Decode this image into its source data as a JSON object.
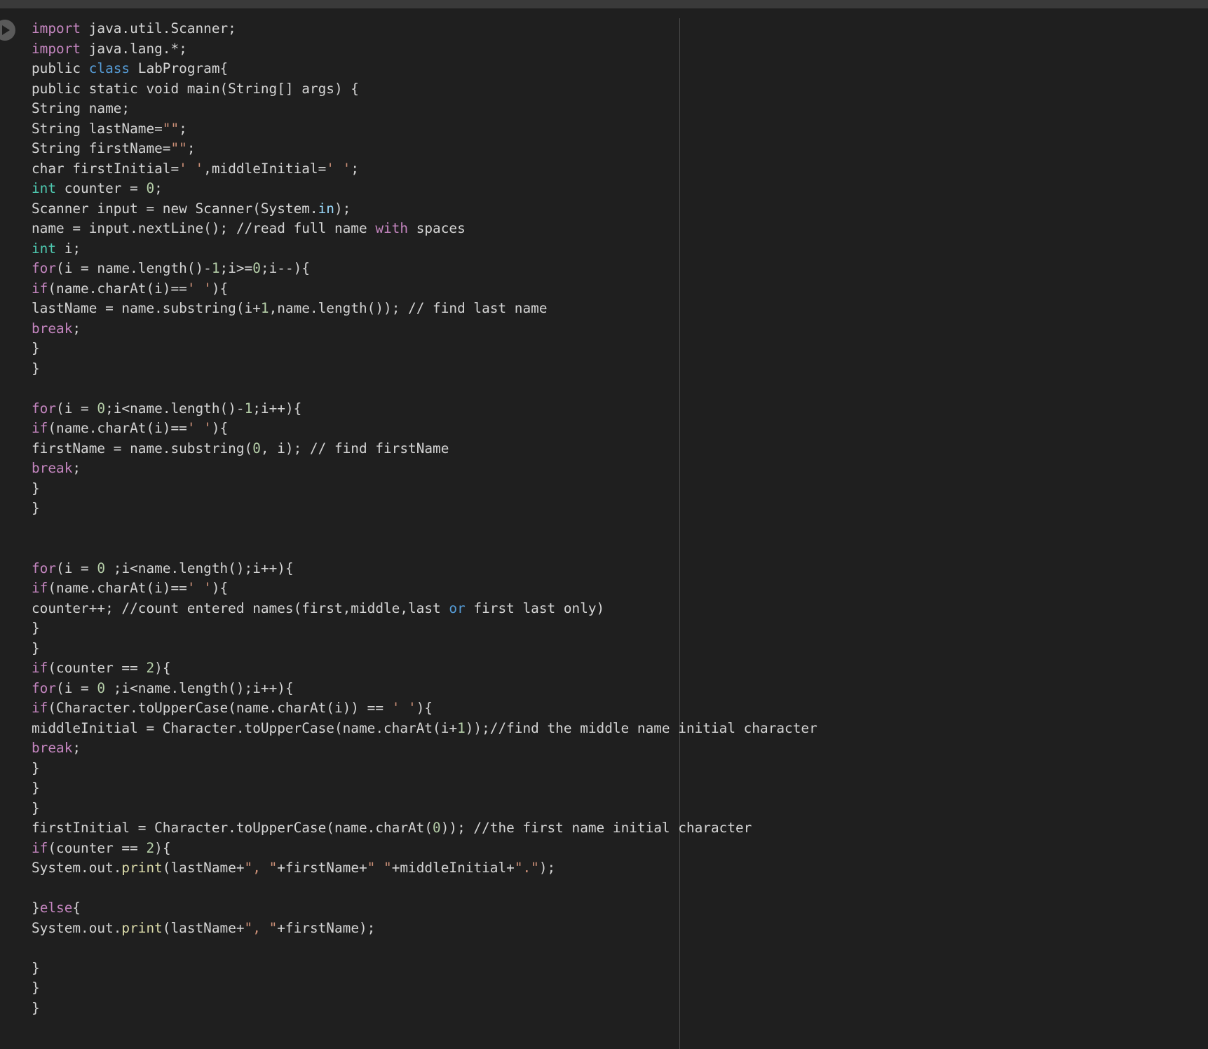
{
  "editor": {
    "run_button_icon": "play-icon",
    "language": "java",
    "lines": [
      [
        {
          "t": "import",
          "c": "kw"
        },
        {
          "t": " java.util.Scanner;"
        }
      ],
      [
        {
          "t": "import",
          "c": "kw"
        },
        {
          "t": " java.lang.*;"
        }
      ],
      [
        {
          "t": "public "
        },
        {
          "t": "class",
          "c": "blue"
        },
        {
          "t": " LabProgram{"
        }
      ],
      [
        {
          "t": "public static void main(String[] args) {"
        }
      ],
      [
        {
          "t": "String name;"
        }
      ],
      [
        {
          "t": "String lastName="
        },
        {
          "t": "\"\"",
          "c": "str"
        },
        {
          "t": ";"
        }
      ],
      [
        {
          "t": "String firstName="
        },
        {
          "t": "\"\"",
          "c": "str"
        },
        {
          "t": ";"
        }
      ],
      [
        {
          "t": "char firstInitial="
        },
        {
          "t": "' '",
          "c": "str"
        },
        {
          "t": ",middleInitial="
        },
        {
          "t": "' '",
          "c": "str"
        },
        {
          "t": ";"
        }
      ],
      [
        {
          "t": "int",
          "c": "teal"
        },
        {
          "t": " counter = "
        },
        {
          "t": "0",
          "c": "num"
        },
        {
          "t": ";"
        }
      ],
      [
        {
          "t": "Scanner input = new Scanner(System."
        },
        {
          "t": "in",
          "c": "field"
        },
        {
          "t": ");"
        }
      ],
      [
        {
          "t": "name = input.nextLine(); //read full name "
        },
        {
          "t": "with",
          "c": "kw"
        },
        {
          "t": " spaces"
        }
      ],
      [
        {
          "t": "int",
          "c": "teal"
        },
        {
          "t": " i;"
        }
      ],
      [
        {
          "t": "for",
          "c": "kw"
        },
        {
          "t": "(i = name.length()-"
        },
        {
          "t": "1",
          "c": "num"
        },
        {
          "t": ";i>="
        },
        {
          "t": "0",
          "c": "num"
        },
        {
          "t": ";i--){"
        }
      ],
      [
        {
          "t": "if",
          "c": "kw"
        },
        {
          "t": "(name.charAt(i)=="
        },
        {
          "t": "' '",
          "c": "str"
        },
        {
          "t": "){"
        }
      ],
      [
        {
          "t": "lastName = name.substring(i+"
        },
        {
          "t": "1",
          "c": "num"
        },
        {
          "t": ",name.length()); // find last name"
        }
      ],
      [
        {
          "t": "break",
          "c": "kw"
        },
        {
          "t": ";"
        }
      ],
      [
        {
          "t": "}"
        }
      ],
      [
        {
          "t": "}"
        }
      ],
      [],
      [
        {
          "t": "for",
          "c": "kw"
        },
        {
          "t": "(i = "
        },
        {
          "t": "0",
          "c": "num"
        },
        {
          "t": ";i<name.length()-"
        },
        {
          "t": "1",
          "c": "num"
        },
        {
          "t": ";i++){"
        }
      ],
      [
        {
          "t": "if",
          "c": "kw"
        },
        {
          "t": "(name.charAt(i)=="
        },
        {
          "t": "' '",
          "c": "str"
        },
        {
          "t": "){"
        }
      ],
      [
        {
          "t": "firstName = name.substring("
        },
        {
          "t": "0",
          "c": "num"
        },
        {
          "t": ", i); // find firstName"
        }
      ],
      [
        {
          "t": "break",
          "c": "kw"
        },
        {
          "t": ";"
        }
      ],
      [
        {
          "t": "}"
        }
      ],
      [
        {
          "t": "}"
        }
      ],
      [],
      [],
      [
        {
          "t": "for",
          "c": "kw"
        },
        {
          "t": "(i = "
        },
        {
          "t": "0",
          "c": "num"
        },
        {
          "t": " ;i<name.length();i++){"
        }
      ],
      [
        {
          "t": "if",
          "c": "kw"
        },
        {
          "t": "(name.charAt(i)=="
        },
        {
          "t": "' '",
          "c": "str"
        },
        {
          "t": "){"
        }
      ],
      [
        {
          "t": "counter++; //count entered names(first,middle,last "
        },
        {
          "t": "or",
          "c": "blue"
        },
        {
          "t": " first last only)"
        }
      ],
      [
        {
          "t": "}"
        }
      ],
      [
        {
          "t": "}"
        }
      ],
      [
        {
          "t": "if",
          "c": "kw"
        },
        {
          "t": "(counter == "
        },
        {
          "t": "2",
          "c": "num"
        },
        {
          "t": "){"
        }
      ],
      [
        {
          "t": "for",
          "c": "kw"
        },
        {
          "t": "(i = "
        },
        {
          "t": "0",
          "c": "num"
        },
        {
          "t": " ;i<name.length();i++){"
        }
      ],
      [
        {
          "t": "if",
          "c": "kw"
        },
        {
          "t": "(Character.toUpperCase(name.charAt(i)) == "
        },
        {
          "t": "' '",
          "c": "str"
        },
        {
          "t": "){"
        }
      ],
      [
        {
          "t": "middleInitial = Character.toUpperCase(name.charAt(i+"
        },
        {
          "t": "1",
          "c": "num"
        },
        {
          "t": "));//find the middle name initial character"
        }
      ],
      [
        {
          "t": "break",
          "c": "kw"
        },
        {
          "t": ";"
        }
      ],
      [
        {
          "t": "}"
        }
      ],
      [
        {
          "t": "}"
        }
      ],
      [
        {
          "t": "}"
        }
      ],
      [
        {
          "t": "firstInitial = Character.toUpperCase(name.charAt("
        },
        {
          "t": "0",
          "c": "num"
        },
        {
          "t": ")); //the first name initial character"
        }
      ],
      [
        {
          "t": "if",
          "c": "kw"
        },
        {
          "t": "(counter == "
        },
        {
          "t": "2",
          "c": "num"
        },
        {
          "t": "){"
        }
      ],
      [
        {
          "t": "System.out."
        },
        {
          "t": "print",
          "c": "fn"
        },
        {
          "t": "(lastName+"
        },
        {
          "t": "\", \"",
          "c": "str"
        },
        {
          "t": "+firstName+"
        },
        {
          "t": "\" \"",
          "c": "str"
        },
        {
          "t": "+middleInitial+"
        },
        {
          "t": "\".\"",
          "c": "str"
        },
        {
          "t": ");"
        }
      ],
      [],
      [
        {
          "t": "}"
        },
        {
          "t": "else",
          "c": "kw"
        },
        {
          "t": "{"
        }
      ],
      [
        {
          "t": "System.out."
        },
        {
          "t": "print",
          "c": "fn"
        },
        {
          "t": "(lastName+"
        },
        {
          "t": "\", \"",
          "c": "str"
        },
        {
          "t": "+firstName);"
        }
      ],
      [],
      [
        {
          "t": "}"
        }
      ],
      [
        {
          "t": "}"
        }
      ],
      [
        {
          "t": "}"
        }
      ]
    ]
  }
}
